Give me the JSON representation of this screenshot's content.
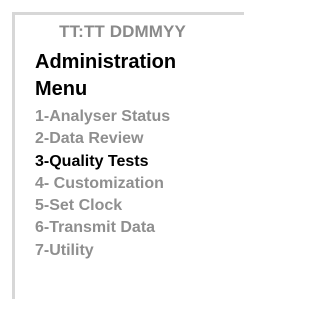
{
  "header": {
    "datetime": "TT:TT DDMMYY"
  },
  "title": {
    "line1": "Administration",
    "line2": "Menu"
  },
  "menu": {
    "items": [
      {
        "label": "1-Analyser Status",
        "selected": false
      },
      {
        "label": "2-Data Review",
        "selected": false
      },
      {
        "label": "3-Quality Tests",
        "selected": true
      },
      {
        "label": "4- Customization",
        "selected": false
      },
      {
        "label": "5-Set Clock",
        "selected": false
      },
      {
        "label": "6-Transmit Data",
        "selected": false
      },
      {
        "label": "7-Utility",
        "selected": false
      }
    ]
  },
  "colors": {
    "selected": "#000000",
    "unselected": "#8f8f8f",
    "header": "#8a8a8a",
    "frame": "#d7d7d7"
  }
}
